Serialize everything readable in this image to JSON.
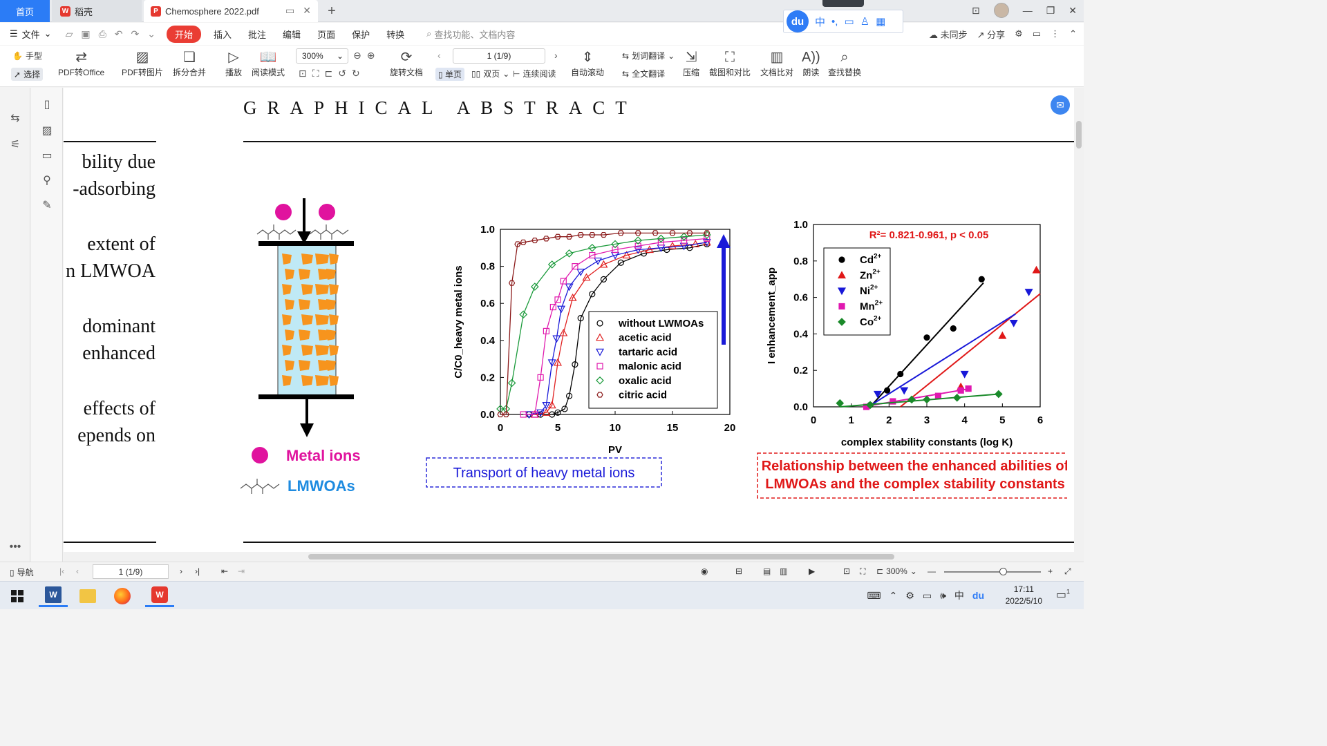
{
  "tabs": {
    "home": "首页",
    "daoke": "稻壳",
    "document": "Chemosphere 2022.pdf",
    "new_tab": "+"
  },
  "menu": {
    "file": "文件",
    "items": [
      "开始",
      "插入",
      "批注",
      "编辑",
      "页面",
      "保护",
      "转换"
    ],
    "search_placeholder": "查找功能、文档内容",
    "sync": "未同步",
    "share": "分享"
  },
  "ime": {
    "logo": "du",
    "lang": "中"
  },
  "toolbar": {
    "hand": "手型",
    "select": "选择",
    "pdf_to_office": "PDF转Office",
    "pdf_to_image": "PDF转图片",
    "split_merge": "拆分合并",
    "play": "播放",
    "reading_mode": "阅读模式",
    "zoom": "300%",
    "rotate": "旋转文档",
    "page_indicator": "1 (1/9)",
    "single_page": "单页",
    "double_page": "双页",
    "continuous": "连续阅读",
    "auto_scroll": "自动滚动",
    "word_translate": "划词翻译",
    "full_translate": "全文翻译",
    "compress": "压缩",
    "screenshot_compare": "截图和对比",
    "doc_compare": "文档比对",
    "read_aloud": "朗读",
    "find_replace": "查找替换"
  },
  "document": {
    "heading": "GRAPHICAL ABSTRACT",
    "body_fragments": [
      "bility due",
      "-adsorbing",
      "extent of",
      "n LMWOA",
      "dominant",
      "enhanced",
      "effects of",
      "epends on"
    ]
  },
  "figure": {
    "legend_metal": "Metal ions",
    "legend_lmwoa": "LMWOAs",
    "caption_transport": "Transport  of heavy metal ions",
    "caption_relationship": [
      "Relationship between the enhanced abilities of",
      "LMWOAs and the complex stability constants"
    ],
    "colors": {
      "metal": "#e0139e",
      "lmwoa": "#1e8be0",
      "column_fill": "#bfe9f5",
      "particle": "#f7941d"
    }
  },
  "chart_data": [
    {
      "type": "scatter",
      "title": "",
      "xlabel": "PV",
      "ylabel": "C/C0_heavy metal ions",
      "xlim": [
        0,
        20
      ],
      "ylim": [
        0,
        1.0
      ],
      "xticks": [
        "0",
        "5",
        "10",
        "15",
        "20"
      ],
      "yticks": [
        "0.0",
        "0.2",
        "0.4",
        "0.6",
        "0.8",
        "1.0"
      ],
      "legend_position": "bottom-right",
      "series": [
        {
          "name": "without LWMOAs",
          "color": "#000000",
          "marker": "circle",
          "x": [
            2.5,
            3.5,
            4.5,
            5.0,
            5.6,
            6.0,
            6.5,
            7.0,
            8.0,
            9.0,
            10.5,
            12.5,
            14.5,
            16.5,
            18.0
          ],
          "y": [
            0.0,
            0.0,
            0.0,
            0.01,
            0.03,
            0.1,
            0.27,
            0.52,
            0.65,
            0.73,
            0.82,
            0.87,
            0.89,
            0.9,
            0.92
          ]
        },
        {
          "name": "acetic acid",
          "color": "#e02020",
          "marker": "triangle-up",
          "x": [
            3.0,
            4.0,
            4.5,
            5.0,
            5.5,
            6.3,
            7.5,
            9.0,
            11.0,
            13.0,
            15.0,
            17.0,
            18.0
          ],
          "y": [
            0.0,
            0.01,
            0.05,
            0.28,
            0.44,
            0.63,
            0.74,
            0.81,
            0.86,
            0.89,
            0.91,
            0.92,
            0.93
          ]
        },
        {
          "name": "tartaric acid",
          "color": "#1a1ad8",
          "marker": "triangle-down",
          "x": [
            2.5,
            3.5,
            4.0,
            4.5,
            4.9,
            5.3,
            6.0,
            7.0,
            8.5,
            10.0,
            12.0,
            14.0,
            16.0,
            18.0
          ],
          "y": [
            0.0,
            0.01,
            0.05,
            0.28,
            0.41,
            0.57,
            0.69,
            0.77,
            0.83,
            0.86,
            0.89,
            0.9,
            0.91,
            0.93
          ]
        },
        {
          "name": "malonic acid",
          "color": "#e01aae",
          "marker": "square",
          "x": [
            2.0,
            3.0,
            3.5,
            4.0,
            4.6,
            5.0,
            5.5,
            6.5,
            8.0,
            10.0,
            12.0,
            14.0,
            16.0,
            18.0
          ],
          "y": [
            0.0,
            0.0,
            0.2,
            0.45,
            0.58,
            0.62,
            0.72,
            0.8,
            0.86,
            0.89,
            0.91,
            0.93,
            0.94,
            0.95
          ]
        },
        {
          "name": "oxalic acid",
          "color": "#1a9a3a",
          "marker": "diamond",
          "x": [
            0.0,
            0.5,
            1.0,
            2.0,
            3.0,
            4.5,
            6.0,
            8.0,
            10.0,
            12.0,
            14.0,
            16.0,
            18.0
          ],
          "y": [
            0.03,
            0.03,
            0.17,
            0.54,
            0.69,
            0.81,
            0.87,
            0.9,
            0.92,
            0.94,
            0.95,
            0.96,
            0.97
          ]
        },
        {
          "name": "citric acid",
          "color": "#8b1a1a",
          "marker": "hexagon",
          "x": [
            0.0,
            0.5,
            1.0,
            1.5,
            2.0,
            3.0,
            4.0,
            5.0,
            6.0,
            7.0,
            8.0,
            9.0,
            10.5,
            12.0,
            13.5,
            15.0,
            16.5,
            18.0
          ],
          "y": [
            0.0,
            0.0,
            0.71,
            0.92,
            0.93,
            0.94,
            0.95,
            0.96,
            0.96,
            0.97,
            0.97,
            0.97,
            0.98,
            0.98,
            0.98,
            0.98,
            0.98,
            0.98
          ]
        }
      ]
    },
    {
      "type": "scatter",
      "title": "R²= 0.821-0.961, p < 0.05",
      "xlabel": "complex stability constants (log K)",
      "ylabel": "I enhancement_app",
      "xlim": [
        0,
        6
      ],
      "ylim": [
        0,
        1.0
      ],
      "xticks": [
        "0",
        "1",
        "2",
        "3",
        "4",
        "5",
        "6"
      ],
      "yticks": [
        "0.0",
        "0.2",
        "0.4",
        "0.6",
        "0.8",
        "1.0"
      ],
      "legend_position": "top-left",
      "series": [
        {
          "name": "Cd",
          "superscript": "2+",
          "color": "#000000",
          "marker": "circle",
          "x": [
            1.5,
            1.95,
            2.3,
            3.0,
            3.7,
            4.45
          ],
          "y": [
            0.01,
            0.09,
            0.18,
            0.38,
            0.43,
            0.7
          ],
          "fit": [
            [
              1.5,
              0.0
            ],
            [
              4.5,
              0.68
            ]
          ]
        },
        {
          "name": "Zn",
          "superscript": "2+",
          "color": "#e01818",
          "marker": "triangle-up",
          "x": [
            3.9,
            5.0,
            5.9
          ],
          "y": [
            0.11,
            0.39,
            0.75
          ],
          "fit": [
            [
              2.3,
              0.0
            ],
            [
              6.0,
              0.62
            ]
          ]
        },
        {
          "name": "Ni",
          "superscript": "2+",
          "color": "#1818d8",
          "marker": "triangle-down",
          "x": [
            1.7,
            2.4,
            4.0,
            5.3,
            5.7
          ],
          "y": [
            0.07,
            0.09,
            0.18,
            0.46,
            0.63
          ],
          "fit": [
            [
              1.45,
              0.0
            ],
            [
              5.35,
              0.51
            ]
          ]
        },
        {
          "name": "Mn",
          "superscript": "2+",
          "color": "#e018b0",
          "marker": "square",
          "x": [
            1.4,
            2.1,
            3.3,
            3.9,
            4.1
          ],
          "y": [
            0.0,
            0.03,
            0.06,
            0.09,
            0.1
          ],
          "fit": [
            [
              1.3,
              0.0
            ],
            [
              4.15,
              0.1
            ]
          ]
        },
        {
          "name": "Co",
          "superscript": "2+",
          "color": "#1a8a2a",
          "marker": "diamond",
          "x": [
            0.7,
            1.5,
            2.6,
            3.0,
            3.8,
            4.9
          ],
          "y": [
            0.02,
            0.01,
            0.04,
            0.04,
            0.05,
            0.07
          ],
          "fit": [
            [
              0.7,
              0.0
            ],
            [
              4.9,
              0.07
            ]
          ]
        }
      ]
    }
  ],
  "statusbar": {
    "nav": "导航",
    "page_indicator": "1 (1/9)",
    "zoom": "300%"
  },
  "taskbar": {
    "time": "17:11",
    "date": "2022/5/10",
    "notify_count": "1"
  }
}
